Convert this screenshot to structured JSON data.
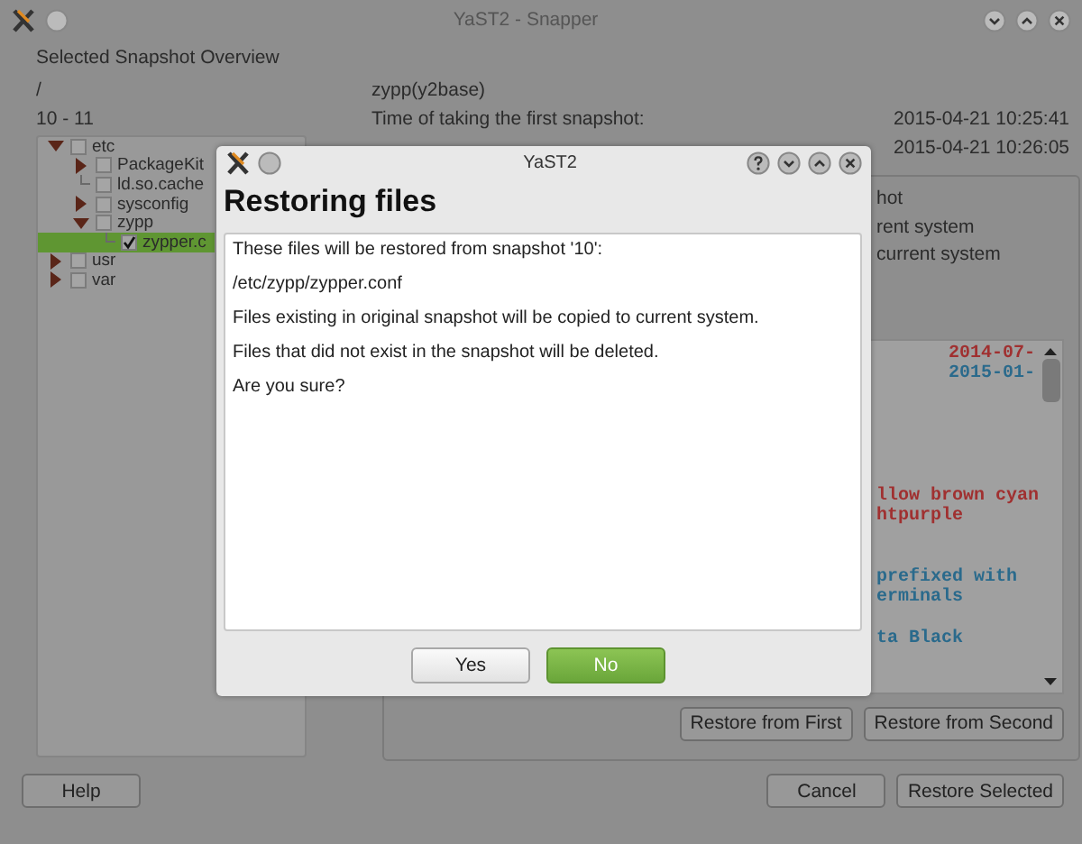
{
  "window": {
    "title": "YaST2 - Snapper"
  },
  "overview": {
    "heading": "Selected Snapshot Overview",
    "path": "/",
    "range": "10 - 11",
    "description": "zypp(y2base)",
    "times": [
      {
        "label": "Time of taking the first snapshot:",
        "value": "2015-04-21 10:25:41"
      },
      {
        "value": "2015-04-21 10:26:05"
      }
    ]
  },
  "tree": [
    {
      "label": "etc",
      "kind": "folder",
      "expanded": true,
      "checked": false,
      "selected": false,
      "children": [
        {
          "label": "PackageKit",
          "kind": "folder",
          "expanded": false,
          "checked": false,
          "selected": false
        },
        {
          "label": "ld.so.cache",
          "kind": "file",
          "checked": false,
          "selected": false
        },
        {
          "label": "sysconfig",
          "kind": "folder",
          "expanded": false,
          "checked": false,
          "selected": false
        },
        {
          "label": "zypp",
          "kind": "folder",
          "expanded": true,
          "checked": false,
          "selected": false,
          "children": [
            {
              "label": "zypper.c",
              "kind": "file",
              "checked": true,
              "selected": true
            }
          ]
        }
      ]
    },
    {
      "label": "usr",
      "kind": "folder",
      "expanded": false,
      "checked": false,
      "selected": false
    },
    {
      "label": "var",
      "kind": "folder",
      "expanded": false,
      "checked": false,
      "selected": false
    }
  ],
  "options": [
    "hot",
    "rent system",
    "current system"
  ],
  "diff": [
    {
      "text": "2014-07-",
      "kind": "date",
      "color": "#a03030"
    },
    {
      "text": "2015-01-",
      "kind": "date",
      "color": "#2a6a8c"
    },
    {
      "text": "llow brown cyan",
      "kind": "line",
      "color": "#a03030"
    },
    {
      "text": "htpurple",
      "kind": "line",
      "color": "#a03030"
    },
    {
      "text": "prefixed with",
      "kind": "line",
      "color": "#2a6a8c"
    },
    {
      "text": "erminals",
      "kind": "line",
      "color": "#2a6a8c"
    },
    {
      "text": "ta Black",
      "kind": "line",
      "color": "#2a6a8c"
    }
  ],
  "panel_buttons": [
    "Restore from First",
    "Restore from Second"
  ],
  "buttons": {
    "left": [
      "Help"
    ],
    "right": [
      "Cancel",
      "Restore Selected"
    ]
  },
  "dialog": {
    "title": "YaST2",
    "heading": "Restoring files",
    "lines": [
      "These files will be restored from snapshot '10':",
      "/etc/zypp/zypper.conf",
      "Files existing in original snapshot will be copied to current system.",
      "Files that did not exist in the snapshot will be deleted.",
      "Are you sure?"
    ],
    "buttons": [
      {
        "label": "Yes",
        "default": false
      },
      {
        "label": "No",
        "default": true
      }
    ]
  }
}
